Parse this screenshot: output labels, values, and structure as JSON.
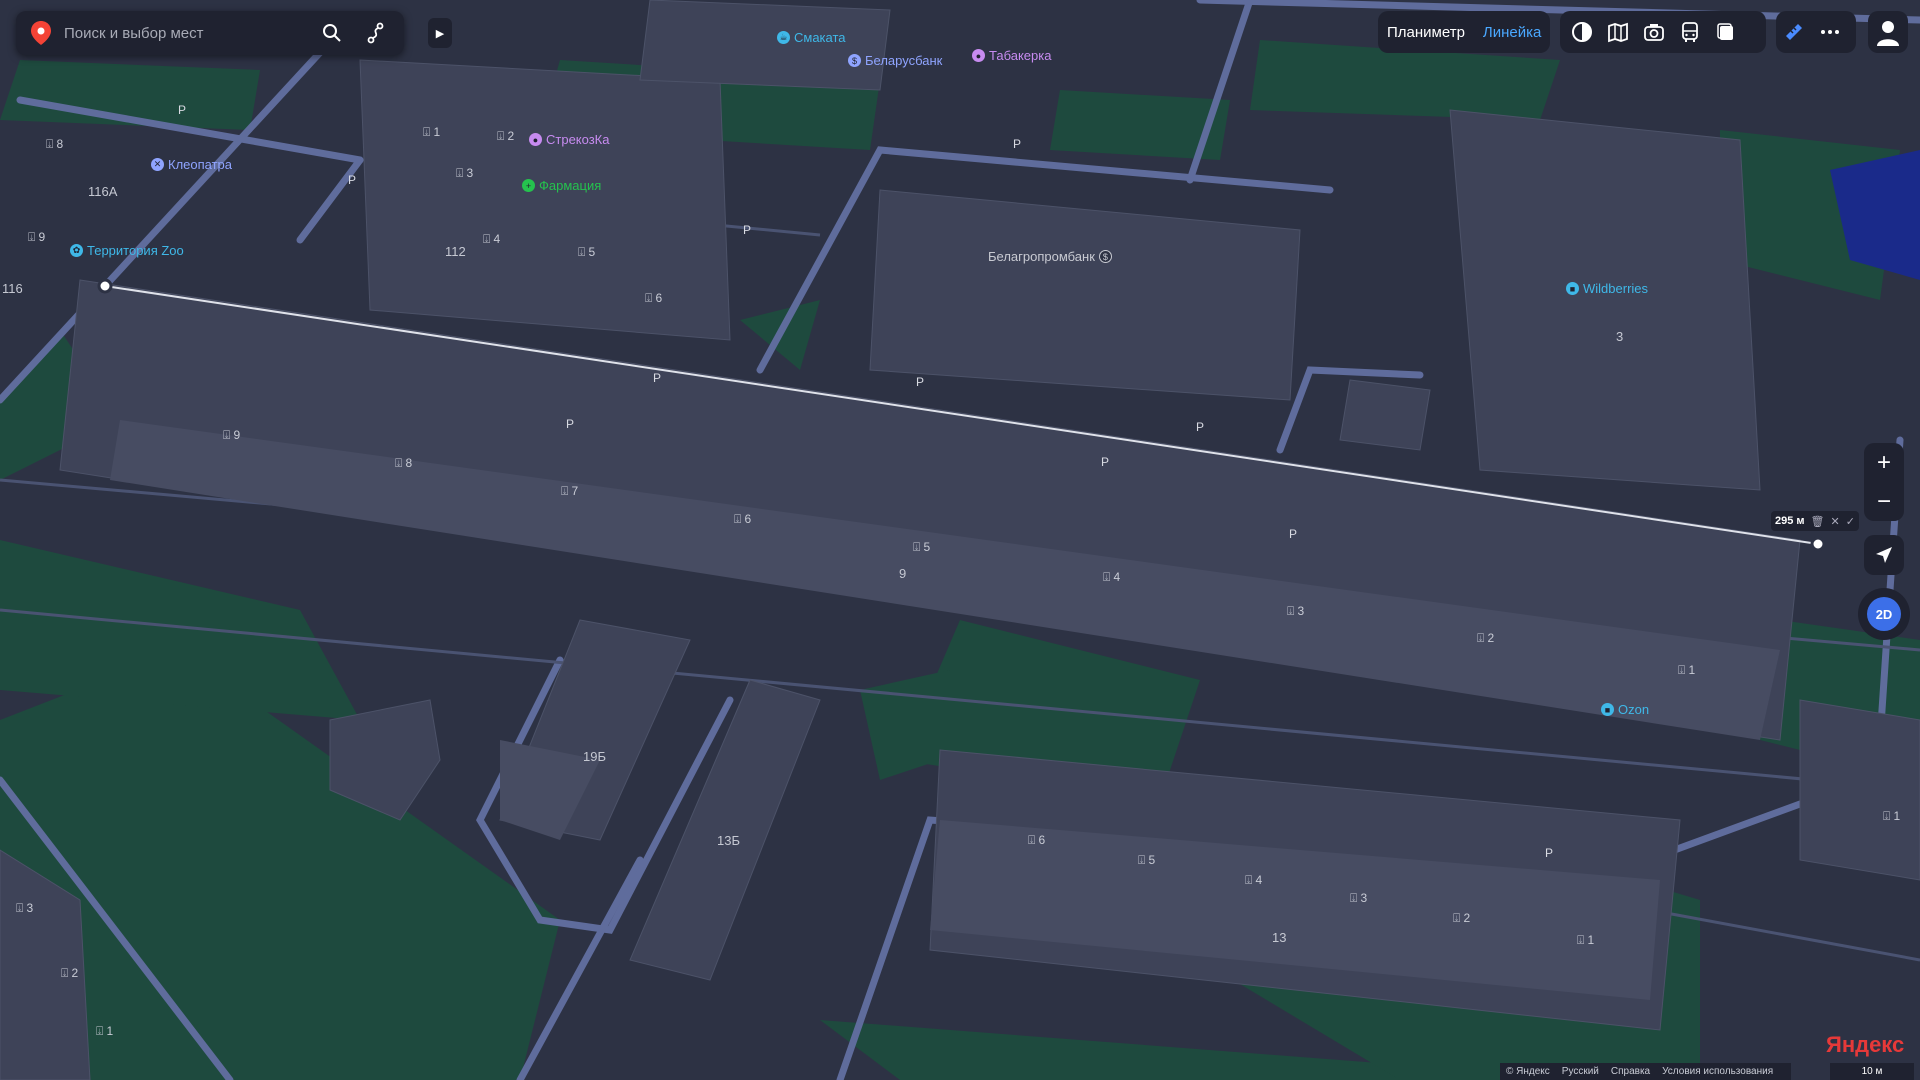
{
  "search": {
    "placeholder": "Поиск и выбор мест"
  },
  "toolbar": {
    "planimeter": "Планиметр",
    "ruler": "Линейка"
  },
  "measure": {
    "distance": "295 м"
  },
  "controls": {
    "zoom_in": "+",
    "zoom_out": "−",
    "mode": "2D"
  },
  "pois": [
    {
      "name": "Смаката",
      "style": "blue"
    },
    {
      "name": "Беларусбанк",
      "style": "lblue"
    },
    {
      "name": "Табакерка",
      "style": "purple"
    },
    {
      "name": "СтрекозКа",
      "style": "purple"
    },
    {
      "name": "Фармация",
      "style": "green"
    },
    {
      "name": "Клеопатра",
      "style": "lblue"
    },
    {
      "name": "Территория Zoo",
      "style": "blue"
    },
    {
      "name": "Белагропромбанк",
      "style": "grey"
    },
    {
      "name": "Wildberries",
      "style": "blue"
    },
    {
      "name": "Ozon",
      "style": "blue"
    }
  ],
  "house_numbers": [
    "116A",
    "116",
    "112",
    "3",
    "9",
    "19Б",
    "13Б",
    "13"
  ],
  "entrances": [
    "8",
    "9",
    "1",
    "2",
    "3",
    "4",
    "5",
    "6",
    "9",
    "8",
    "7",
    "6",
    "5",
    "4",
    "3",
    "2",
    "1",
    "6",
    "5",
    "4",
    "3",
    "2",
    "1",
    "3",
    "2",
    "1",
    "1"
  ],
  "parking": "P",
  "footer": {
    "copyright": "© Яндекс",
    "language": "Русский",
    "help": "Справка",
    "terms": "Условия использования"
  },
  "logo": "Яндекс",
  "scale": "10 м"
}
